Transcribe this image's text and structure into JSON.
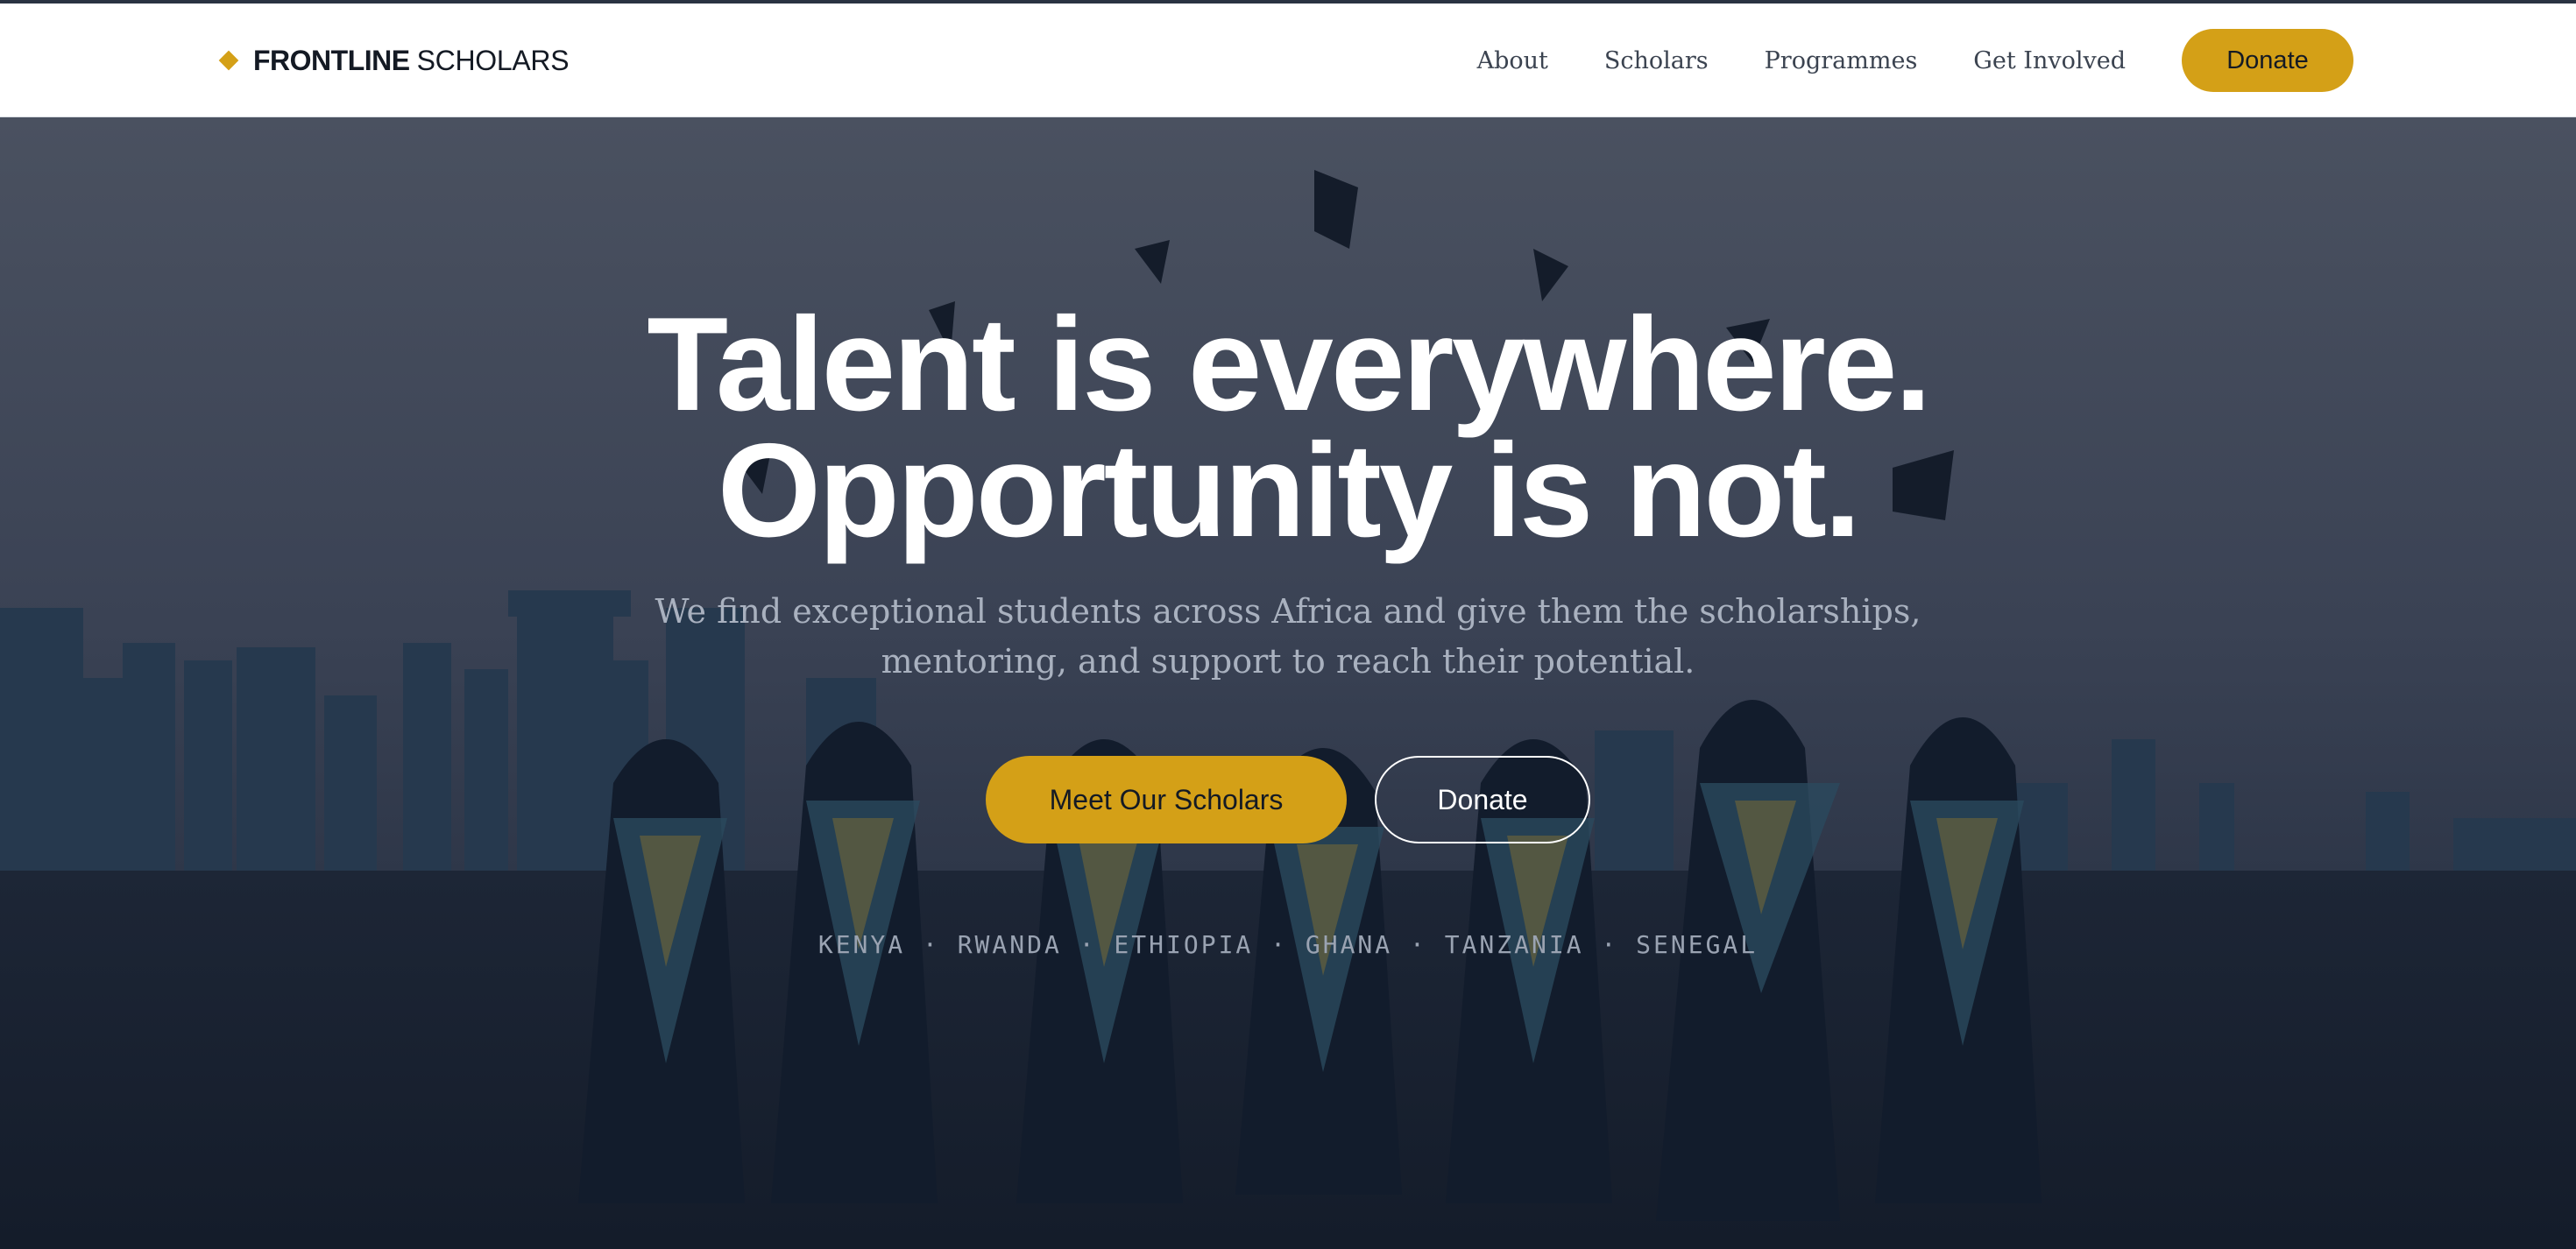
{
  "header": {
    "logo_bold": "FRONTLINE",
    "logo_light": "SCHOLARS",
    "nav": [
      "About",
      "Scholars",
      "Programmes",
      "Get Involved"
    ],
    "donate_label": "Donate"
  },
  "hero": {
    "headline_line1": "Talent is everywhere.",
    "headline_line2": "Opportunity is not.",
    "subtitle": "We find exceptional students across Africa and give them the scholarships, mentoring, and support to reach their potential.",
    "primary_cta": "Meet Our Scholars",
    "secondary_cta": "Donate",
    "countries": "KENYA · RWANDA · ETHIOPIA · GHANA · TANZANIA · SENEGAL"
  },
  "colors": {
    "accent": "#d4a017",
    "overlay": "#0f1b2d",
    "header_bg": "#ffffff"
  },
  "icons": {
    "logo_mark": "diamond-icon"
  }
}
